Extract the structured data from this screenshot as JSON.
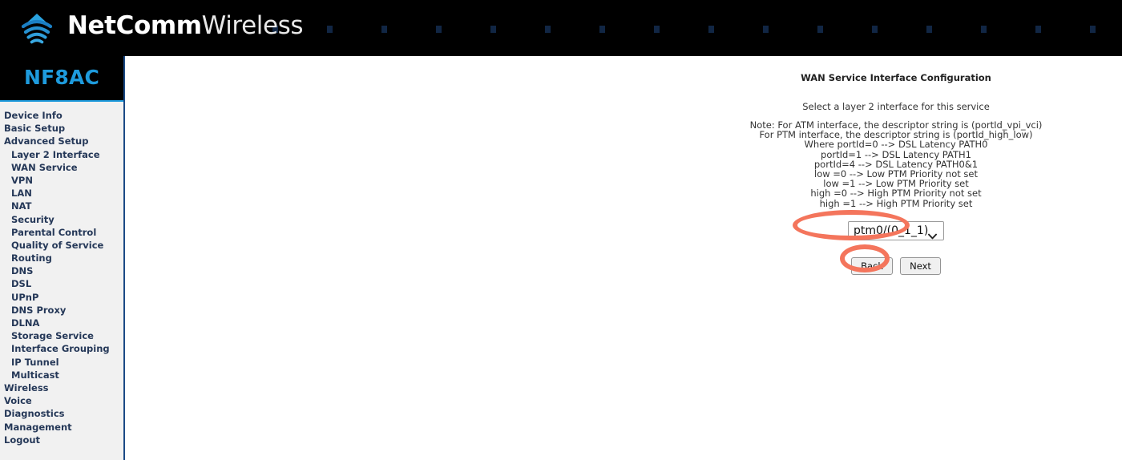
{
  "banner": {
    "logo_icon": "wifi-signal-icon",
    "brand_primary": "NetComm",
    "brand_secondary": "Wireless",
    "background_color": "#000000"
  },
  "sidebar": {
    "device_name": "NF8AC",
    "device_name_color": "#1e9bdd",
    "background_color": "#f1f1f1",
    "border_color": "#1b4a86",
    "items": [
      {
        "label": "Device Info",
        "level": 0
      },
      {
        "label": "Basic Setup",
        "level": 0
      },
      {
        "label": "Advanced Setup",
        "level": 0
      },
      {
        "label": "Layer 2 Interface",
        "level": 1
      },
      {
        "label": "WAN Service",
        "level": 1
      },
      {
        "label": "VPN",
        "level": 1
      },
      {
        "label": "LAN",
        "level": 1
      },
      {
        "label": "NAT",
        "level": 1
      },
      {
        "label": "Security",
        "level": 1
      },
      {
        "label": "Parental Control",
        "level": 1
      },
      {
        "label": "Quality of Service",
        "level": 1
      },
      {
        "label": "Routing",
        "level": 1
      },
      {
        "label": "DNS",
        "level": 1
      },
      {
        "label": "DSL",
        "level": 1
      },
      {
        "label": "UPnP",
        "level": 1
      },
      {
        "label": "DNS Proxy",
        "level": 1
      },
      {
        "label": "DLNA",
        "level": 1
      },
      {
        "label": "Storage Service",
        "level": 1
      },
      {
        "label": "Interface Grouping",
        "level": 1
      },
      {
        "label": "IP Tunnel",
        "level": 1
      },
      {
        "label": "Multicast",
        "level": 1
      },
      {
        "label": "Wireless",
        "level": 0
      },
      {
        "label": "Voice",
        "level": 0
      },
      {
        "label": "Diagnostics",
        "level": 0
      },
      {
        "label": "Management",
        "level": 0
      },
      {
        "label": "Logout",
        "level": 0
      }
    ]
  },
  "main": {
    "title": "WAN Service Interface Configuration",
    "subtitle": "Select a layer 2 interface for this service",
    "note_lines": [
      "Note: For ATM interface, the descriptor string is (portId_vpi_vci)",
      "For PTM interface, the descriptor string is (portId_high_low)",
      "Where portId=0 --> DSL Latency PATH0",
      "portId=1 --> DSL Latency PATH1",
      "portId=4 --> DSL Latency PATH0&1",
      "low =0 --> Low PTM Priority not set",
      "low =1 --> Low PTM Priority set",
      "high =0 --> High PTM Priority not set",
      "high =1 --> High PTM Priority set"
    ],
    "interface_select": {
      "selected": "ptm0/(0_1_1)",
      "options": [
        "ptm0/(0_1_1)"
      ],
      "arrow_icon": "chevron-down-icon"
    },
    "buttons": {
      "back": "Back",
      "next": "Next"
    }
  },
  "annotations": {
    "highlight_color": "#f4755c",
    "targets": [
      "interface-select",
      "next-button"
    ]
  }
}
